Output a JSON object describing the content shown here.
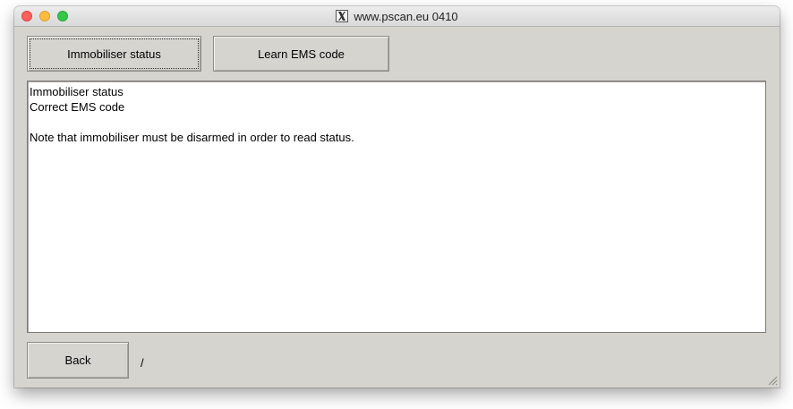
{
  "window": {
    "title": "www.pscan.eu 0410"
  },
  "toolbar": {
    "immobiliser_status_label": "Immobiliser status",
    "learn_ems_code_label": "Learn EMS code"
  },
  "output": {
    "lines": [
      "Immobiliser status",
      "Correct EMS code",
      "",
      "Note that immobiliser must be disarmed in order to read status."
    ]
  },
  "footer": {
    "back_label": "Back",
    "status_text": "/"
  },
  "colors": {
    "window_bg": "#d6d4cf",
    "close": "#fc605c",
    "minimize": "#fdbc40",
    "maximize": "#34c84a"
  },
  "icons": {
    "title_icon": "x11-icon",
    "resize": "resize-grip-icon"
  }
}
